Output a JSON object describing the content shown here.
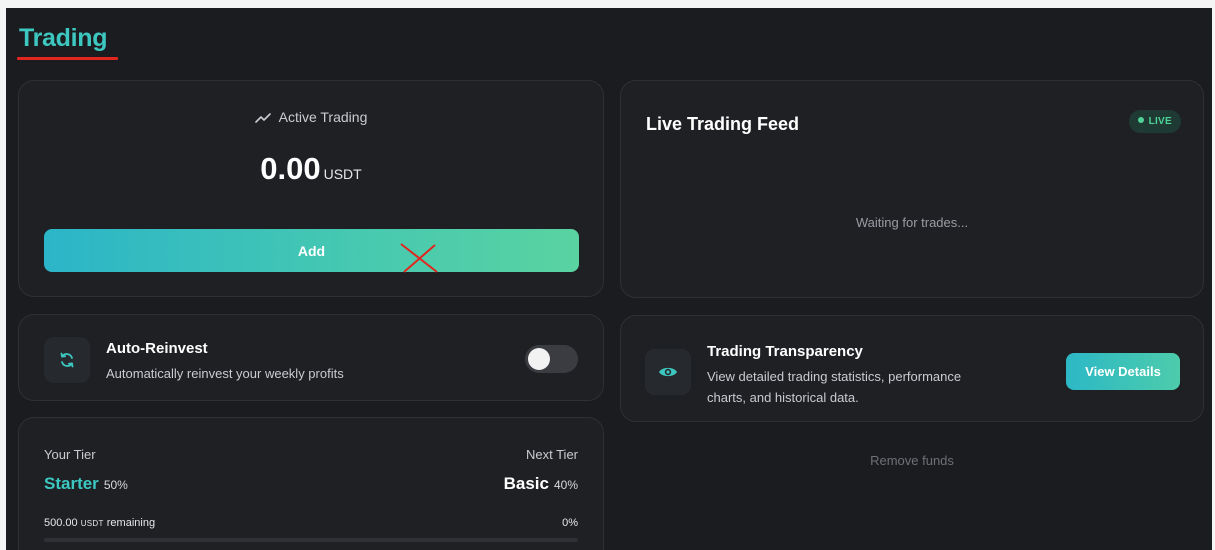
{
  "page": {
    "title": "Trading"
  },
  "active_trading": {
    "label": "Active Trading",
    "amount": "0.00",
    "unit": "USDT",
    "add_label": "Add"
  },
  "live_feed": {
    "title": "Live Trading Feed",
    "badge": "LIVE",
    "empty_text": "Waiting for trades..."
  },
  "auto_reinvest": {
    "title": "Auto-Reinvest",
    "description": "Automatically reinvest your weekly profits",
    "enabled": false
  },
  "transparency": {
    "title": "Trading Transparency",
    "description_line1": "View detailed trading statistics, performance",
    "description_line2": "charts, and historical data.",
    "button_label": "View Details"
  },
  "remove_funds_label": "Remove funds",
  "tier": {
    "your_tier_label": "Your Tier",
    "next_tier_label": "Next Tier",
    "current_name": "Starter",
    "current_pct": "50%",
    "next_name": "Basic",
    "next_pct": "40%",
    "remaining_amount": "500.00",
    "remaining_unit": "USDT",
    "remaining_suffix": "remaining",
    "progress_text": "0%",
    "progress_fraction": 0
  },
  "colors": {
    "accent": "#3cc8c0",
    "annotation_mark": "#e0261f",
    "live": "#4fd39a"
  },
  "icons": {
    "active_trading": "trend-line-icon",
    "reinvest": "refresh-icon",
    "transparency": "eye-icon"
  }
}
